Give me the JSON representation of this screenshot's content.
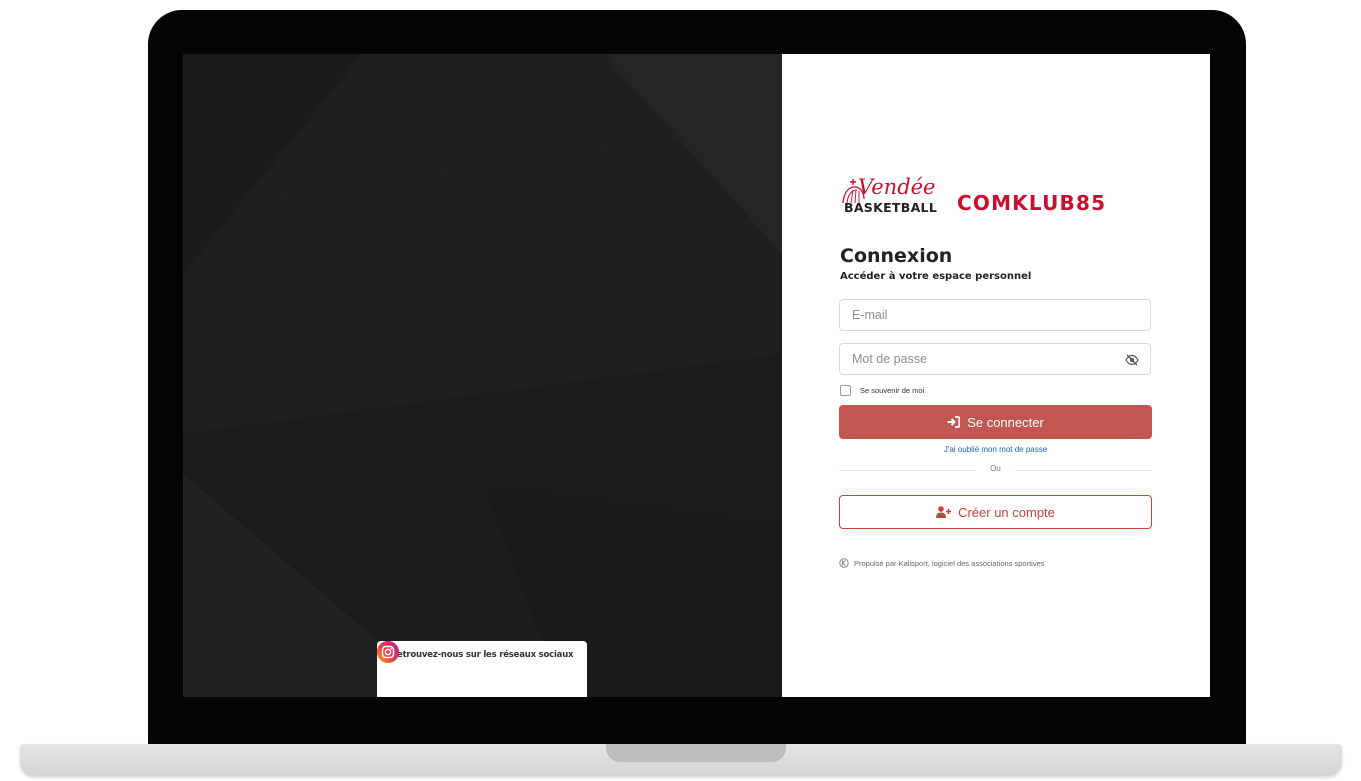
{
  "social": {
    "title": "Retrouvez-nous sur les réseaux sociaux",
    "icons": [
      "facebook-icon",
      "instagram-icon"
    ]
  },
  "brand": {
    "script": "Vendée",
    "basketball": "BASKETBALL",
    "name": "COMKLUB85",
    "color": "#c8102e"
  },
  "login": {
    "title": "Connexion",
    "subtitle": "Accéder à votre espace personnel",
    "email_placeholder": "E-mail",
    "password_placeholder": "Mot de passe",
    "remember_label": "Se souvenir de moi",
    "login_button": "Se connecter",
    "forgot_link": "J'ai oublié mon mot de passe",
    "divider_text": "Ou",
    "register_button": "Créer un compte",
    "powered_by": "Propulsé par Kalisport, logiciel des associations sportives"
  },
  "colors": {
    "login_button_bg": "#c25752",
    "register_border": "#c7423b",
    "link": "#1a64b3",
    "left_panel_bg": "#1d1d1e"
  }
}
